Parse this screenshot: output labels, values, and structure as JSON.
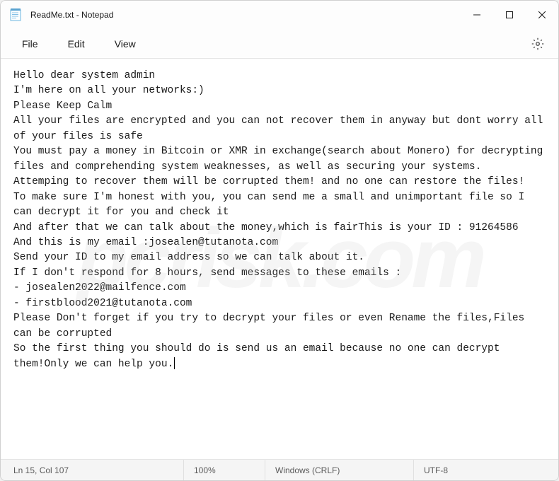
{
  "window": {
    "title": "ReadMe.txt - Notepad"
  },
  "menu": {
    "file": "File",
    "edit": "Edit",
    "view": "View"
  },
  "content": "Hello dear system admin\nI'm here on all your networks:)\nPlease Keep Calm\nAll your files are encrypted and you can not recover them in anyway but dont worry all of your files is safe\nYou must pay a money in Bitcoin or XMR in exchange(search about Monero) for decrypting files and comprehending system weaknesses, as well as securing your systems.\nAttemping to recover them will be corrupted them! and no one can restore the files!\nTo make sure I'm honest with you, you can send me a small and unimportant file so I can decrypt it for you and check it\nAnd after that we can talk about the money,which is fairThis is your ID : 91264586\nAnd this is my email :josealen@tutanota.com\nSend your ID to my email address so we can talk about it.\nIf I don't respond for 8 hours, send messages to these emails :\n- josealen2022@mailfence.com\n- firstblood2021@tutanota.com\nPlease Don't forget if you try to decrypt your files or even Rename the files,Files can be corrupted\nSo the first thing you should do is send us an email because no one can decrypt them!Only we can help you.",
  "status": {
    "position": "Ln 15, Col 107",
    "zoom": "100%",
    "line_ending": "Windows (CRLF)",
    "encoding": "UTF-8"
  }
}
